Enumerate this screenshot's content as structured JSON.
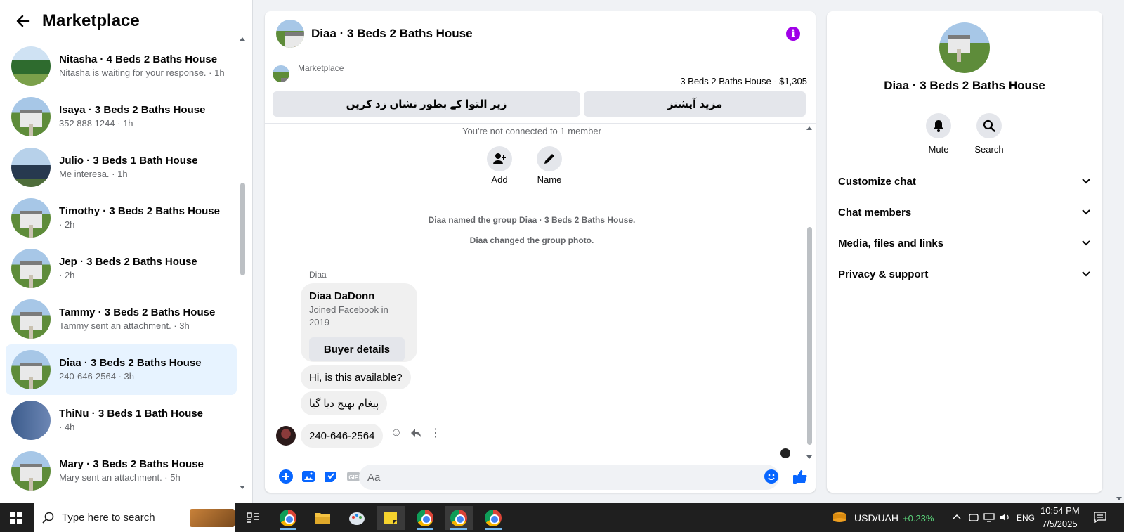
{
  "sidebar": {
    "title": "Marketplace",
    "conversations": [
      {
        "name": "Nitasha · 4 Beds 2 Baths House",
        "sub": "Nitasha is waiting for your response. · 1h",
        "thumb": "green"
      },
      {
        "name": "Isaya · 3 Beds 2 Baths House",
        "sub": "352 888 1244 · 1h",
        "thumb": "house"
      },
      {
        "name": "Julio · 3 Beds 1 Bath House",
        "sub": "Me interesa. · 1h",
        "thumb": "dark"
      },
      {
        "name": "Timothy · 3 Beds 2 Baths House",
        "sub": " · 2h",
        "thumb": "house"
      },
      {
        "name": "Jep · 3 Beds 2 Baths House",
        "sub": " · 2h",
        "thumb": "house"
      },
      {
        "name": "Tammy · 3 Beds 2 Baths House",
        "sub": "Tammy sent an attachment. · 3h",
        "thumb": "house"
      },
      {
        "name": "Diaa · 3 Beds 2 Baths House",
        "sub": "240-646-2564 · 3h",
        "thumb": "house",
        "active": true
      },
      {
        "name": "ThiNu · 3 Beds 1 Bath House",
        "sub": " · 4h",
        "thumb": "blue"
      },
      {
        "name": "Mary · 3 Beds 2 Baths House",
        "sub": "Mary sent an attachment. · 5h",
        "thumb": "house"
      }
    ]
  },
  "chat": {
    "title": "Diaa · 3 Beds 2 Baths House",
    "marketplace_label": "Marketplace",
    "listing": "3 Beds 2 Baths House - $1,305",
    "btn_mark_pending": "زیر التوا کے بطور نشان زد کریں",
    "btn_more_options": "مزید آپشنز",
    "notice": "You're not connected to 1 member",
    "action_add": "Add",
    "action_name": "Name",
    "sys_named": "Diaa named the group Diaa · 3 Beds 2 Baths House.",
    "sys_photo": "Diaa changed the group photo.",
    "sender": "Diaa",
    "card_name": "Diaa DaDonn",
    "card_sub": "Joined Facebook in 2019",
    "card_btn": "Buyer details",
    "msg1": "Hi, is this available?",
    "msg2": "پیغام بھیج دیا گیا",
    "msg3": "240-646-2564",
    "composer_placeholder": "Aa",
    "colors": {
      "accent": "#0866ff",
      "info": "#a000e8"
    }
  },
  "details": {
    "title": "Diaa · 3 Beds 2 Baths House",
    "mute": "Mute",
    "search": "Search",
    "rows": [
      "Customize chat",
      "Chat members",
      "Media, files and links",
      "Privacy & support"
    ]
  },
  "taskbar": {
    "search_placeholder": "Type here to search",
    "currency": "USD/UAH",
    "currency_change": "+0.23%",
    "lang": "ENG",
    "time": "10:54 PM",
    "date": "7/5/2025"
  }
}
